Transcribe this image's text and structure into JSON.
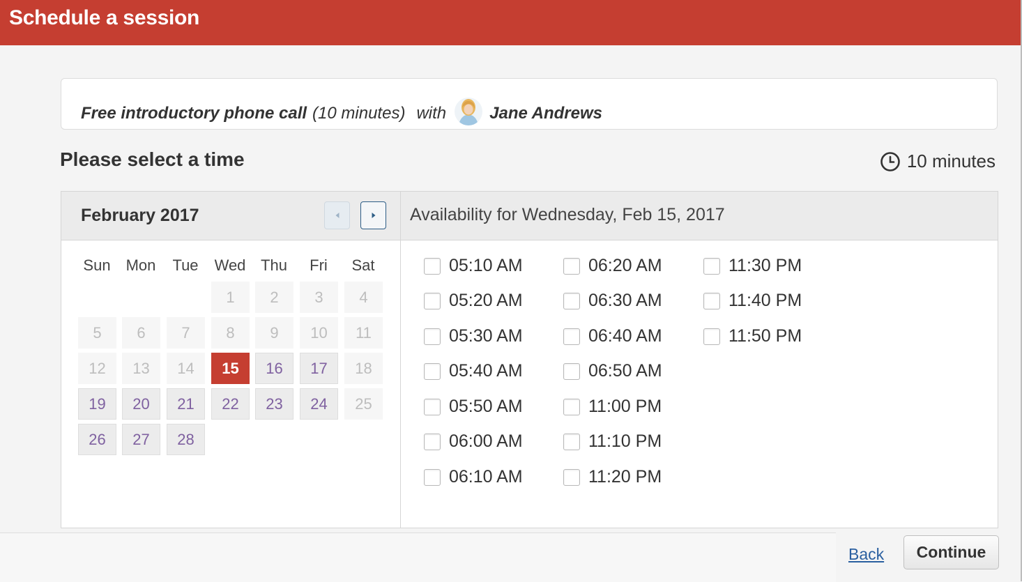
{
  "header": {
    "title": "Schedule a session"
  },
  "session": {
    "service": "Free introductory phone call",
    "duration_paren": "(10 minutes)",
    "with": "with",
    "provider": "Jane Andrews"
  },
  "section_title": "Please select a time",
  "duration_label": "10 minutes",
  "calendar": {
    "month": "February 2017",
    "weekdays": [
      "Sun",
      "Mon",
      "Tue",
      "Wed",
      "Thu",
      "Fri",
      "Sat"
    ],
    "selected_day": 15,
    "weeks": [
      [
        null,
        null,
        null,
        {
          "d": "1",
          "s": "disabled"
        },
        {
          "d": "2",
          "s": "disabled"
        },
        {
          "d": "3",
          "s": "disabled"
        },
        {
          "d": "4",
          "s": "disabled"
        }
      ],
      [
        {
          "d": "5",
          "s": "disabled"
        },
        {
          "d": "6",
          "s": "disabled"
        },
        {
          "d": "7",
          "s": "disabled"
        },
        {
          "d": "8",
          "s": "disabled"
        },
        {
          "d": "9",
          "s": "disabled"
        },
        {
          "d": "10",
          "s": "disabled"
        },
        {
          "d": "11",
          "s": "disabled"
        }
      ],
      [
        {
          "d": "12",
          "s": "disabled"
        },
        {
          "d": "13",
          "s": "disabled"
        },
        {
          "d": "14",
          "s": "disabled"
        },
        {
          "d": "15",
          "s": "selected"
        },
        {
          "d": "16",
          "s": "available"
        },
        {
          "d": "17",
          "s": "available"
        },
        {
          "d": "18",
          "s": "disabled"
        }
      ],
      [
        {
          "d": "19",
          "s": "available"
        },
        {
          "d": "20",
          "s": "available"
        },
        {
          "d": "21",
          "s": "available"
        },
        {
          "d": "22",
          "s": "available"
        },
        {
          "d": "23",
          "s": "available"
        },
        {
          "d": "24",
          "s": "available"
        },
        {
          "d": "25",
          "s": "disabled"
        }
      ],
      [
        {
          "d": "26",
          "s": "available"
        },
        {
          "d": "27",
          "s": "available"
        },
        {
          "d": "28",
          "s": "available"
        },
        null,
        null,
        null,
        null
      ]
    ]
  },
  "availability": {
    "heading": "Availability for Wednesday, Feb 15, 2017",
    "columns": [
      [
        "05:10 AM",
        "05:20 AM",
        "05:30 AM",
        "05:40 AM",
        "05:50 AM",
        "06:00 AM",
        "06:10 AM"
      ],
      [
        "06:20 AM",
        "06:30 AM",
        "06:40 AM",
        "06:50 AM",
        "11:00 PM",
        "11:10 PM",
        "11:20 PM"
      ],
      [
        "11:30 PM",
        "11:40 PM",
        "11:50 PM"
      ]
    ]
  },
  "footer": {
    "back": "Back",
    "continue": "Continue"
  },
  "colors": {
    "brand": "#c53e31",
    "available_day_text": "#7f61a0",
    "link": "#2a5fa0"
  }
}
